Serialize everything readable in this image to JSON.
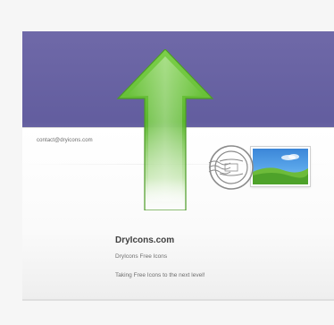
{
  "envelope": {
    "sender": "contact@dryicons.com",
    "address": {
      "name": "DryIcons.com",
      "line1": "DryIcons Free Icons",
      "line2": "Taking Free Icons to the next level!"
    }
  },
  "icons": {
    "arrow": "upload-arrow-icon",
    "stamp": "postage-stamp-icon",
    "postmark": "postmark-icon"
  },
  "colors": {
    "band": "#6f69a8",
    "arrow": "#5cb82e",
    "envelope": "#ffffff"
  }
}
